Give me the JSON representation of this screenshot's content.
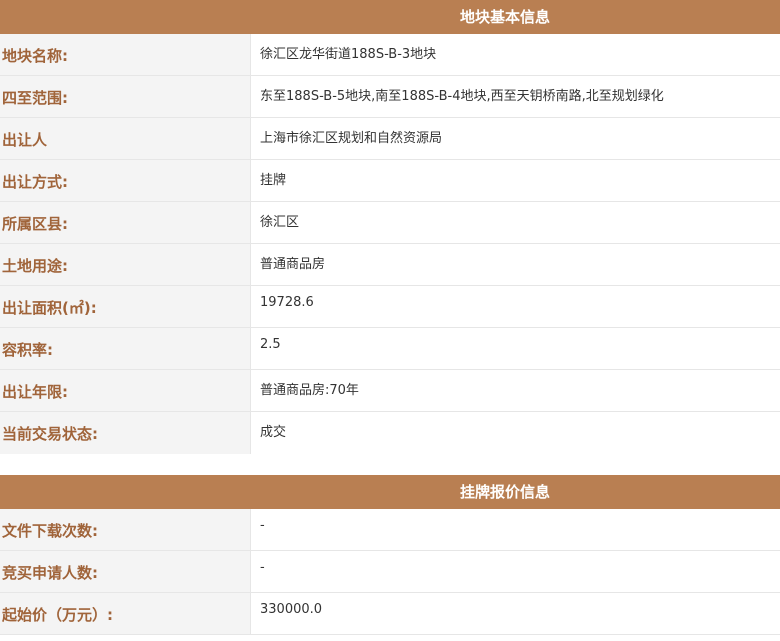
{
  "basic_info": {
    "title": "地块基本信息",
    "rows": [
      {
        "label": "地块名称:",
        "value": "徐汇区龙华街道188S-B-3地块"
      },
      {
        "label": "四至范围:",
        "value": "东至188S-B-5地块,南至188S-B-4地块,西至天钥桥南路,北至规划绿化"
      },
      {
        "label": "出让人",
        "value": "上海市徐汇区规划和自然资源局"
      },
      {
        "label": "出让方式:",
        "value": "挂牌"
      },
      {
        "label": "所属区县:",
        "value": "徐汇区"
      },
      {
        "label": "土地用途:",
        "value": "普通商品房"
      },
      {
        "label": "出让面积(㎡):",
        "value": "19728.6"
      },
      {
        "label": "容积率:",
        "value": "2.5"
      },
      {
        "label": "出让年限:",
        "value": "普通商品房:70年"
      },
      {
        "label": "当前交易状态:",
        "value": "成交"
      }
    ]
  },
  "bid_info": {
    "title": "挂牌报价信息",
    "rows": [
      {
        "label": "文件下载次数:",
        "value": "-"
      },
      {
        "label": "竞买申请人数:",
        "value": "-"
      },
      {
        "label": "起始价（万元）:",
        "value": "330000.0"
      }
    ]
  },
  "colors": {
    "header_bg": "#b97f52",
    "label_text": "#a0643a",
    "label_bg": "#f4f4f4"
  }
}
